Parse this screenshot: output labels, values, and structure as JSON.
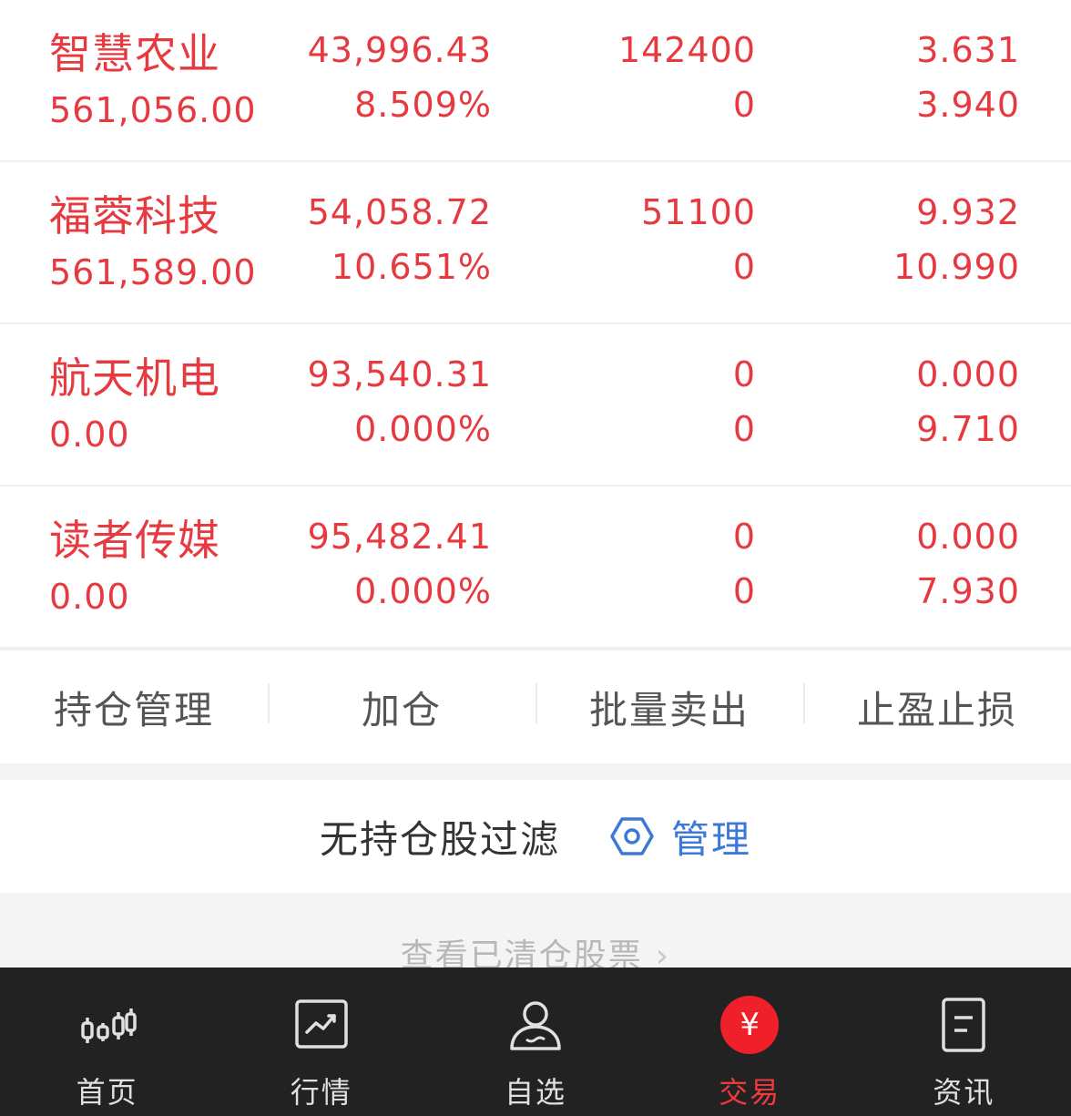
{
  "holdings": [
    {
      "name": "智慧农业",
      "market_value": "561,056.00",
      "profit_loss": "43,996.43",
      "profit_ratio": "8.509%",
      "position": "142400",
      "available": "0",
      "cost": "3.631",
      "price": "3.940"
    },
    {
      "name": "福蓉科技",
      "market_value": "561,589.00",
      "profit_loss": "54,058.72",
      "profit_ratio": "10.651%",
      "position": "51100",
      "available": "0",
      "cost": "9.932",
      "price": "10.990"
    },
    {
      "name": "航天机电",
      "market_value": "0.00",
      "profit_loss": "93,540.31",
      "profit_ratio": "0.000%",
      "position": "0",
      "available": "0",
      "cost": "0.000",
      "price": "9.710"
    },
    {
      "name": "读者传媒",
      "market_value": "0.00",
      "profit_loss": "95,482.41",
      "profit_ratio": "0.000%",
      "position": "0",
      "available": "0",
      "cost": "0.000",
      "price": "7.930"
    }
  ],
  "actions": {
    "manage_positions": "持仓管理",
    "add_position": "加仓",
    "batch_sell": "批量卖出",
    "stop_profit_loss": "止盈止损"
  },
  "filter": {
    "text": "无持仓股过滤",
    "manage_label": "管理",
    "manage_icon": "hexagon-settings-icon"
  },
  "cleared_link": {
    "text": "查看已清仓股票",
    "icon": "chevron-right-icon"
  },
  "tabbar": {
    "tabs": [
      {
        "label": "首页",
        "icon": "candlestick-icon"
      },
      {
        "label": "行情",
        "icon": "trend-chart-icon"
      },
      {
        "label": "自选",
        "icon": "user-icon"
      },
      {
        "label": "交易",
        "icon": "yen-icon",
        "glyph": "¥"
      },
      {
        "label": "资讯",
        "icon": "document-icon"
      }
    ],
    "active_index": 3
  },
  "colors": {
    "stock_red": "#e63a40",
    "link_blue": "#3d78d8",
    "tabbar_bg": "#222222",
    "active_tab": "#f03a3e"
  }
}
